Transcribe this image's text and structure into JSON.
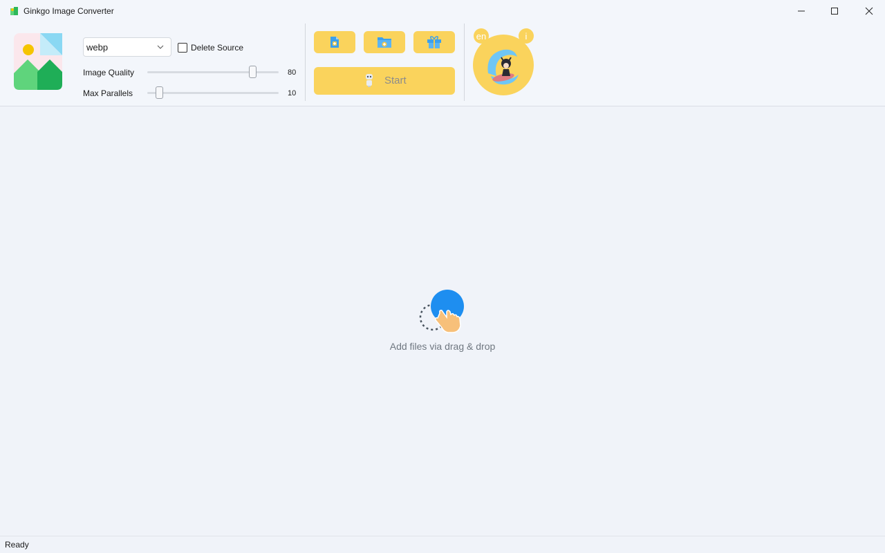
{
  "window": {
    "title": "Ginkgo Image Converter",
    "controls": {
      "minimize": "minimize-icon",
      "maximize": "maximize-icon",
      "close": "close-icon"
    }
  },
  "toolbar": {
    "format_select": {
      "value": "webp"
    },
    "delete_source": {
      "label": "Delete Source",
      "checked": false
    },
    "image_quality": {
      "label": "Image Quality",
      "value": "80"
    },
    "max_parallels": {
      "label": "Max Parallels",
      "value": "10"
    },
    "icon_buttons": [
      "add-file-icon",
      "add-folder-icon",
      "gift-icon"
    ],
    "start_button": {
      "label": "Start"
    },
    "language_badge": "en",
    "info_badge": "i"
  },
  "drop_zone": {
    "text": "Add files via drag & drop"
  },
  "status_bar": {
    "text": "Ready"
  },
  "colors": {
    "accent_yellow": "#fad35c",
    "background": "#f0f3f9",
    "drop_blue": "#1e8ef0"
  }
}
